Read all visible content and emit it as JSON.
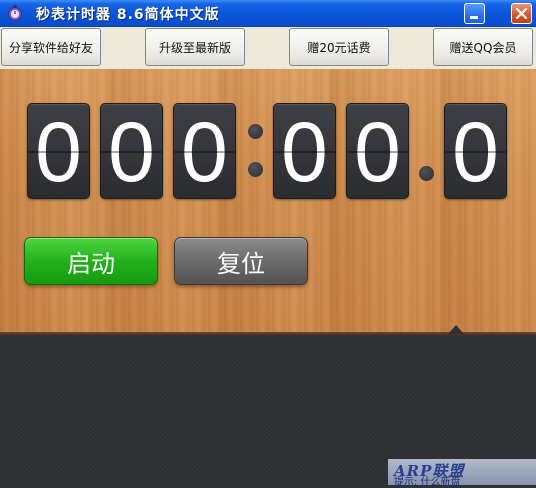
{
  "window": {
    "title": "秒表计时器 8.6简体中文版",
    "icon": "stopwatch-app-icon"
  },
  "toolbar": {
    "buttons": [
      {
        "label": "分享软件给好友"
      },
      {
        "label": "升级至最新版"
      },
      {
        "label": "赠20元话费"
      },
      {
        "label": "赠送QQ会员"
      }
    ]
  },
  "timer": {
    "hours": [
      "0",
      "0",
      "0"
    ],
    "minutes": [
      "0",
      "0"
    ],
    "tenths": "0"
  },
  "controls": {
    "start_label": "启动",
    "reset_label": "复位"
  },
  "watermark": {
    "main": "ARP联盟",
    "sub": "提示: 什么新盘"
  },
  "colors": {
    "titlebar": "#0a55d8",
    "wood": "#cf8d4f",
    "digit_bg": "#2f3135",
    "start_green": "#24b01c",
    "reset_gray": "#6b6b6b"
  }
}
